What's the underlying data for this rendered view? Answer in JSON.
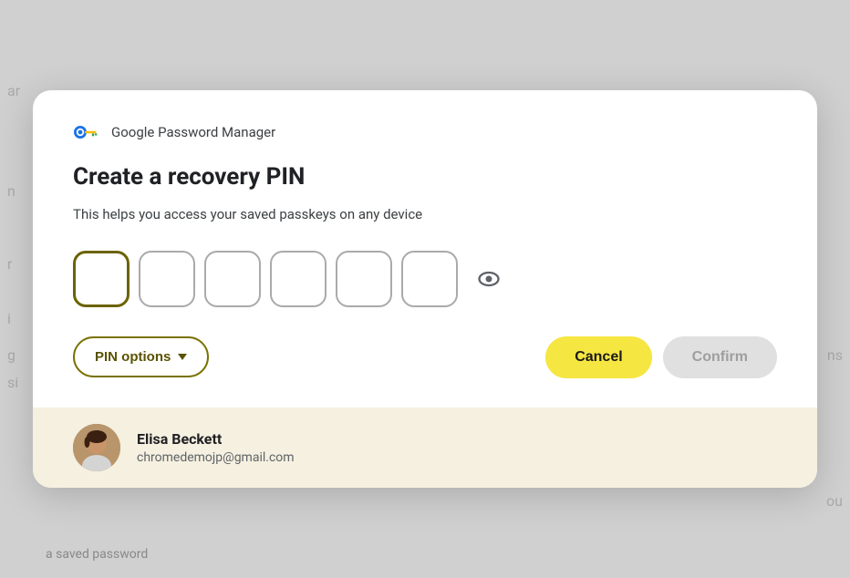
{
  "dialog": {
    "brand": "Google Password Manager",
    "title": "Create a recovery PIN",
    "description": "This helps you access your saved passkeys on any device",
    "pin_boxes": [
      {
        "id": 1,
        "active": true,
        "value": ""
      },
      {
        "id": 2,
        "active": false,
        "value": ""
      },
      {
        "id": 3,
        "active": false,
        "value": ""
      },
      {
        "id": 4,
        "active": false,
        "value": ""
      },
      {
        "id": 5,
        "active": false,
        "value": ""
      },
      {
        "id": 6,
        "active": false,
        "value": ""
      }
    ],
    "actions": {
      "pin_options_label": "PIN options",
      "cancel_label": "Cancel",
      "confirm_label": "Confirm"
    }
  },
  "footer": {
    "user_name": "Elisa Beckett",
    "user_email": "chromedemojp@gmail.com"
  },
  "background": {
    "left_text_1": "ar",
    "left_text_2": "n",
    "left_text_3": "r",
    "left_text_4": "i",
    "left_text_5": "g",
    "left_text_6": "si",
    "right_text_1": "ns",
    "right_text_2": "ou",
    "bottom_text": "a saved password"
  }
}
